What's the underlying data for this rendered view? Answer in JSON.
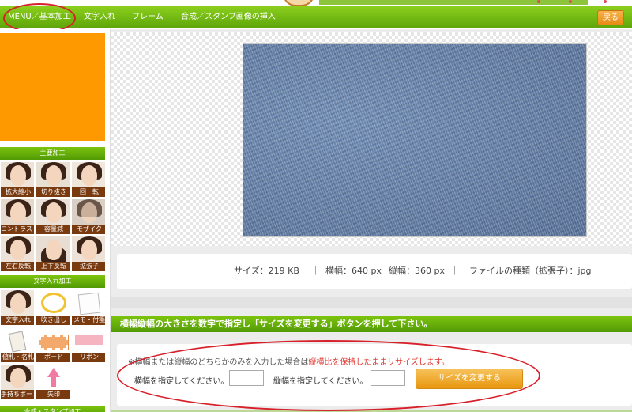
{
  "menubar": {
    "items": [
      "MENU／基本加工",
      "文字入れ",
      "フレーム",
      "合成／スタンプ画像の挿入"
    ],
    "back_label": "戻る"
  },
  "sidebar": {
    "sections": [
      {
        "title": "主要加工",
        "tiles": [
          "拡大縮小",
          "切り抜き",
          "回　転",
          "コントラスト",
          "容量減",
          "モザイク",
          "左右反転",
          "上下反転",
          "拡張子"
        ]
      },
      {
        "title": "文字入れ加工",
        "tiles": [
          "文字入れ",
          "吹き出し",
          "メモ・付箋",
          "値札・名札",
          "ボード",
          "リボン",
          "手持ちボード",
          "矢印"
        ]
      },
      {
        "title": "合成・スタンプ加工"
      }
    ]
  },
  "info": {
    "size": "サイズ：219 KB",
    "sep": "｜",
    "width": "横幅：640 px",
    "height": "縦幅：360 px",
    "type": "ファイルの種類（拡張子）：jpg"
  },
  "resize": {
    "heading": "横幅縦幅の大きさを数字で指定し「サイズを変更する」ボタンを押して下さい。",
    "note_prefix": "※横幅または縦幅のどちらかのみを入力した場合は",
    "note_red": "縦横比を保持したままリサイズします。",
    "width_label": "横幅を指定してください。",
    "height_label": "縦幅を指定してください。",
    "width_value": "",
    "height_value": "",
    "submit_label": "サイズを変更する"
  },
  "colors": {
    "menu_green": "#6cb314",
    "annotation_red": "#d8202a",
    "ad_orange": "#ff9900",
    "button_orange": "#e8960e"
  }
}
